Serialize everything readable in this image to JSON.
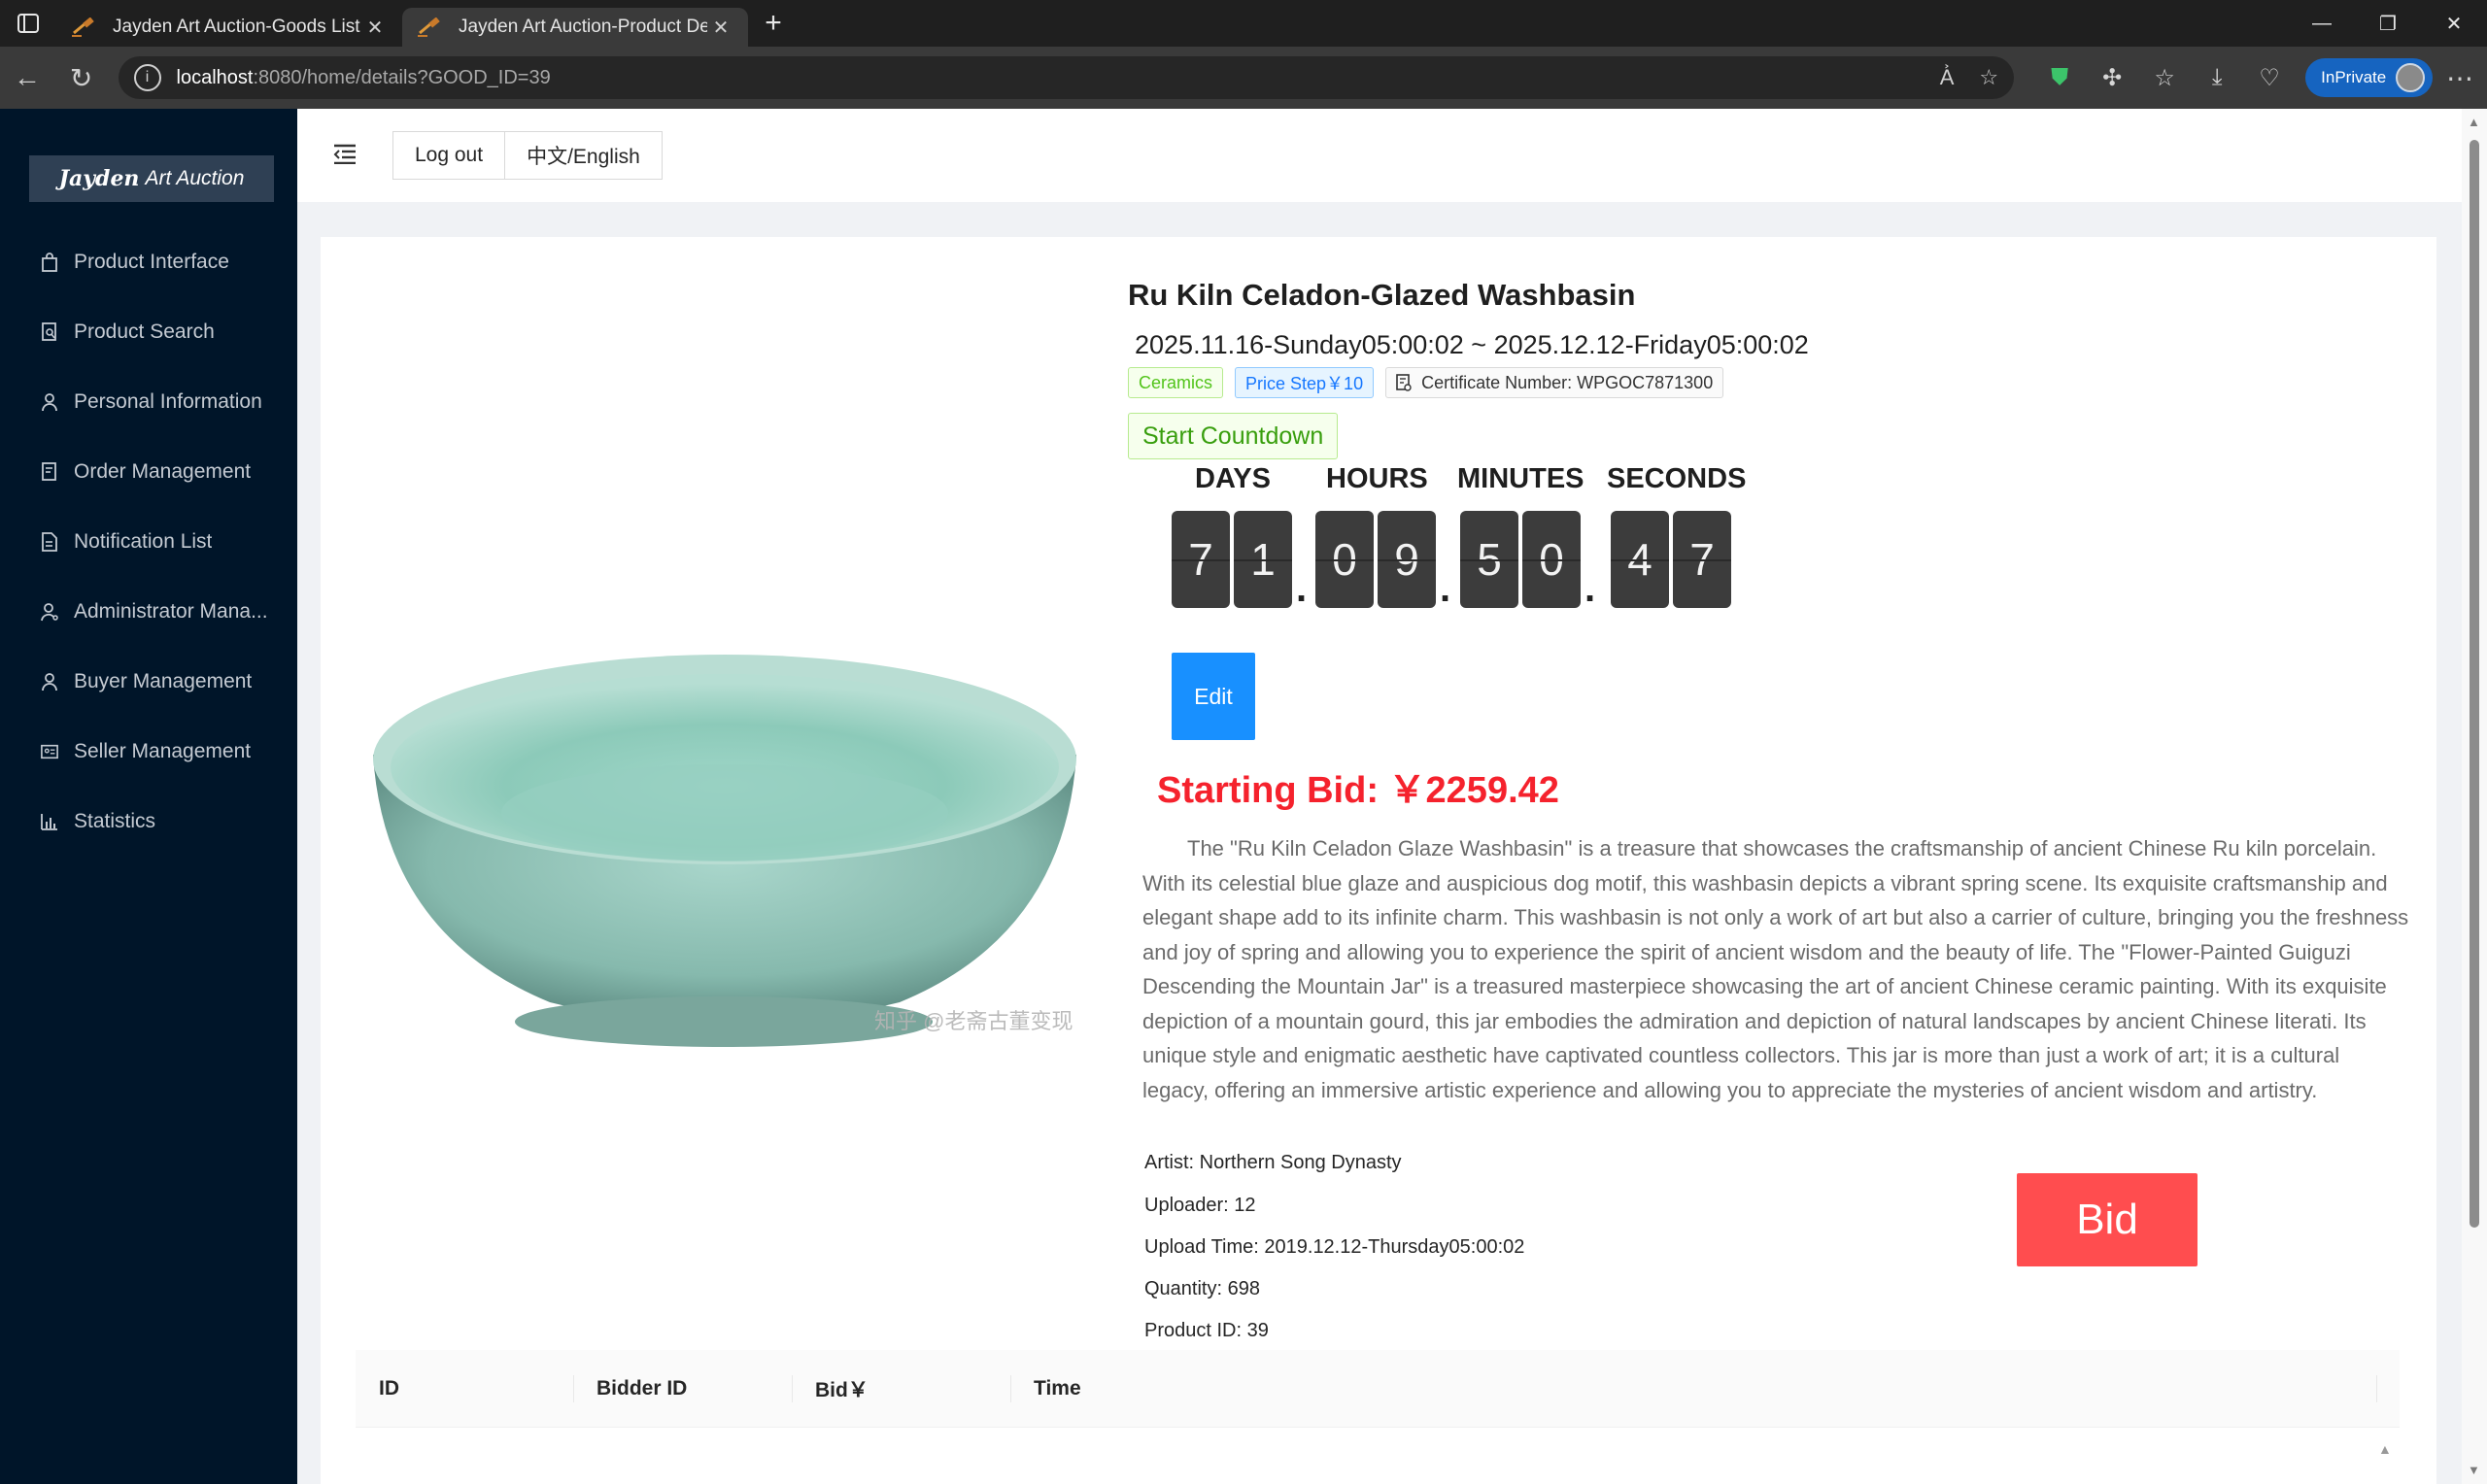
{
  "browser": {
    "tabs": [
      {
        "title": "Jayden Art Auction-Goods List",
        "active": false
      },
      {
        "title": "Jayden Art Auction-Product Detai",
        "active": true
      }
    ],
    "url_host": "localhost",
    "url_rest": ":8080/home/details?GOOD_ID=39",
    "inprivate_label": "InPrivate"
  },
  "logo": {
    "part1": "Jayden",
    "part2": "Art Auction"
  },
  "sidebar": {
    "items": [
      {
        "label": "Product Interface",
        "icon": "shopping-bag-icon"
      },
      {
        "label": "Product Search",
        "icon": "search-doc-icon"
      },
      {
        "label": "Personal Information",
        "icon": "user-icon"
      },
      {
        "label": "Order Management",
        "icon": "order-doc-icon"
      },
      {
        "label": "Notification List",
        "icon": "file-text-icon"
      },
      {
        "label": "Administrator Mana...",
        "icon": "user-admin-icon"
      },
      {
        "label": "Buyer Management",
        "icon": "user-icon"
      },
      {
        "label": "Seller Management",
        "icon": "id-card-icon"
      },
      {
        "label": "Statistics",
        "icon": "bar-chart-icon"
      }
    ]
  },
  "header": {
    "logout": "Log out",
    "language": "中文/English"
  },
  "product": {
    "title": "Ru Kiln Celadon-Glazed Washbasin",
    "date_range": "2025.11.16-Sunday05:00:02 ~ 2025.12.12-Friday05:00:02",
    "tag_category": "Ceramics",
    "tag_price_step": "Price Step￥10",
    "tag_certificate": "Certificate Number: WPGOC7871300",
    "countdown_button": "Start Countdown",
    "countdown_labels": {
      "days": "DAYS",
      "hours": "HOURS",
      "minutes": "MINUTES",
      "seconds": "SECONDS"
    },
    "digits": [
      "7",
      "1",
      "0",
      "9",
      "5",
      "0",
      "4",
      "7"
    ],
    "edit_label": "Edit",
    "starting_bid": "Starting Bid: ￥2259.42",
    "description": "The \"Ru Kiln Celadon Glaze Washbasin\" is a treasure that showcases the craftsmanship of ancient Chinese Ru kiln porcelain. With its celestial blue glaze and auspicious dog motif, this washbasin depicts a vibrant spring scene. Its exquisite craftsmanship and elegant shape add to its infinite charm. This washbasin is not only a work of art but also a carrier of culture, bringing you the freshness and joy of spring and allowing you to experience the spirit of ancient wisdom and the beauty of life. The \"Flower-Painted Guiguzi Descending the Mountain Jar\" is a treasured masterpiece showcasing the art of ancient Chinese ceramic painting. With its exquisite depiction of a mountain gourd, this jar embodies the admiration and depiction of natural landscapes by ancient Chinese literati. Its unique style and enigmatic aesthetic have captivated countless collectors. This jar is more than just a work of art; it is a cultural legacy, offering an immersive artistic experience and allowing you to appreciate the mysteries of ancient wisdom and artistry.",
    "artist": "Artist: Northern Song Dynasty",
    "uploader": "Uploader: 12",
    "upload_time": "Upload Time: 2019.12.12-Thursday05:00:02",
    "quantity": "Quantity: 698",
    "product_id": "Product ID: 39",
    "bid_label": "Bid",
    "image_watermark": "知乎 @老斋古董变现"
  },
  "bids_table": {
    "columns": [
      "ID",
      "Bidder ID",
      "Bid￥",
      "Time"
    ]
  },
  "colors": {
    "sidebar_bg": "#001529",
    "primary": "#1890ff",
    "danger": "#ff4d4f",
    "bid_red": "#f5222d",
    "success": "#52c41a"
  }
}
